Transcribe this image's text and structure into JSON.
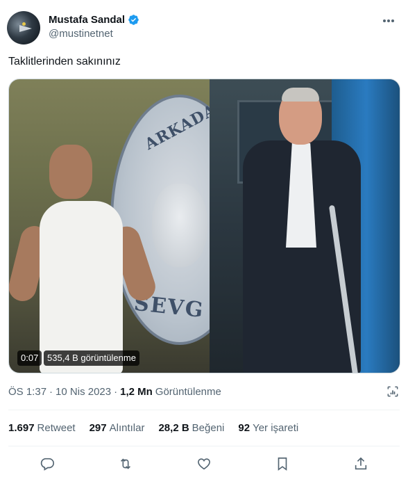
{
  "author": {
    "name": "Mustafa Sandal",
    "handle": "@mustinetnet",
    "verified": true
  },
  "tweet": {
    "text": "Taklitlerinden sakınınız"
  },
  "media": {
    "plaque_text_top": "ARKADAŞ",
    "plaque_text_bottom": "SEVG",
    "duration": "0:07",
    "views": "535,4 B görüntülenme"
  },
  "meta": {
    "time": "ÖS 1:37",
    "sep1": "·",
    "date": "10 Nis 2023",
    "sep2": "·",
    "views_count": "1,2 Mn",
    "views_label": "Görüntülenme"
  },
  "stats": [
    {
      "count": "1.697",
      "label": "Retweet"
    },
    {
      "count": "297",
      "label": "Alıntılar"
    },
    {
      "count": "28,2 B",
      "label": "Beğeni"
    },
    {
      "count": "92",
      "label": "Yer işareti"
    }
  ],
  "colors": {
    "verified": "#1d9bf0",
    "icon": "#536471",
    "text": "#0f1419"
  },
  "actions": [
    "reply-icon",
    "retweet-icon",
    "like-icon",
    "bookmark-icon",
    "share-icon"
  ]
}
